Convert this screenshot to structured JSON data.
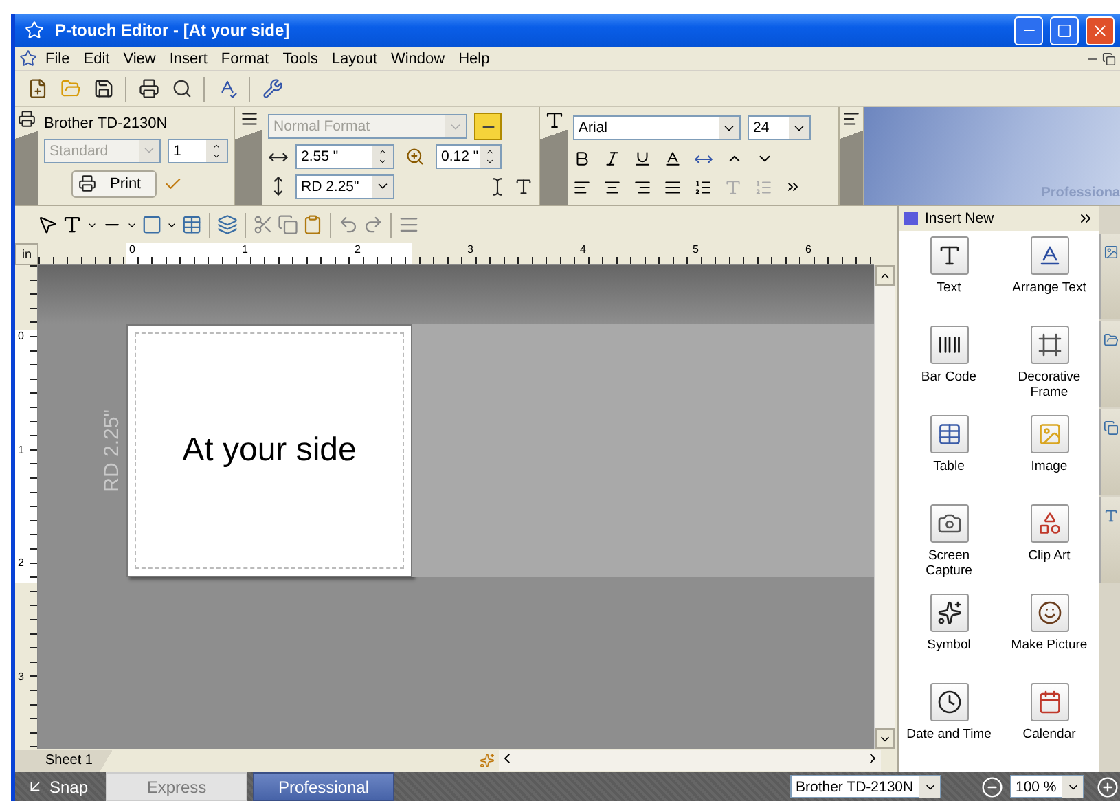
{
  "window": {
    "title": "P-touch Editor - [At your side]"
  },
  "menu": [
    "File",
    "Edit",
    "View",
    "Insert",
    "Format",
    "Tools",
    "Layout",
    "Window",
    "Help"
  ],
  "printer_panel": {
    "printer": "Brother TD-2130N",
    "paper": {
      "value": "Standard",
      "disabled": true
    },
    "copies": "1",
    "print_button": "Print"
  },
  "layout_panel": {
    "format": {
      "value": "Normal Format",
      "disabled": true
    },
    "width": "2.55 \"",
    "margin": "0.12 \"",
    "length": "RD 2.25\""
  },
  "font_panel": {
    "family": "Arial",
    "size": "24"
  },
  "banner": {
    "text": "Professiona"
  },
  "ruler": {
    "unit": "in",
    "h_marks": [
      "0",
      "1",
      "2",
      "3",
      "4",
      "5",
      "6"
    ],
    "v_marks": [
      "0",
      "1",
      "2",
      "3"
    ]
  },
  "canvas": {
    "label_size": "RD 2.25\"",
    "text": "At your side"
  },
  "sheet_tab": "Sheet 1",
  "insert_panel": {
    "title": "Insert New",
    "items": [
      {
        "kind": "text",
        "label": "Text"
      },
      {
        "kind": "arrange",
        "label": "Arrange Text"
      },
      {
        "kind": "barcode",
        "label": "Bar Code"
      },
      {
        "kind": "frame",
        "label": "Decorative Frame"
      },
      {
        "kind": "table",
        "label": "Table"
      },
      {
        "kind": "image",
        "label": "Image"
      },
      {
        "kind": "capture",
        "label": "Screen Capture"
      },
      {
        "kind": "clipart",
        "label": "Clip Art"
      },
      {
        "kind": "symbol",
        "label": "Symbol"
      },
      {
        "kind": "picture",
        "label": "Make Picture"
      },
      {
        "kind": "datetime",
        "label": "Date and Time"
      },
      {
        "kind": "calendar",
        "label": "Calendar"
      }
    ]
  },
  "bottom_bar": {
    "snap": "Snap",
    "modes": [
      {
        "label": "Express",
        "selected": false
      },
      {
        "label": "Professional",
        "selected": true
      }
    ],
    "printer": "Brother TD-2130N",
    "zoom": "100 %"
  }
}
